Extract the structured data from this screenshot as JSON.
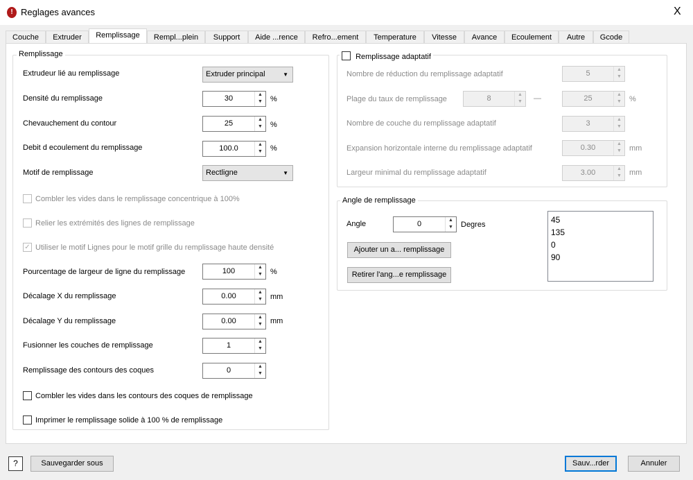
{
  "window": {
    "title": "Reglages avances",
    "close": "X"
  },
  "tabs": [
    "Couche",
    "Extruder",
    "Remplissage",
    "Rempl...plein",
    "Support",
    "Aide ...rence",
    "Refro...ement",
    "Temperature",
    "Vitesse",
    "Avance",
    "Ecoulement",
    "Autre",
    "Gcode"
  ],
  "active_tab": "Remplissage",
  "left": {
    "title": "Remplissage",
    "extruder_label": "Extrudeur lié au remplissage",
    "extruder_value": "Extruder principal",
    "density_label": "Densité du remplissage",
    "density_value": "30",
    "density_unit": "%",
    "overlap_label": "Chevauchement du contour",
    "overlap_value": "25",
    "overlap_unit": "%",
    "flow_label": "Debit d ecoulement du remplissage",
    "flow_value": "100.0",
    "flow_unit": "%",
    "pattern_label": "Motif de remplissage",
    "pattern_value": "Rectligne",
    "cb1": "Combler les vides dans le remplissage concentrique à 100%",
    "cb2": "Relier les extrémités des lignes de remplissage",
    "cb3": "Utiliser le motif Lignes pour le motif grille du remplissage haute densité",
    "width_label": "Pourcentage de largeur de ligne du remplissage",
    "width_value": "100",
    "width_unit": "%",
    "offx_label": "Décalage X du remplissage",
    "offx_value": "0.00",
    "offx_unit": "mm",
    "offy_label": "Décalage Y du remplissage",
    "offy_value": "0.00",
    "offy_unit": "mm",
    "merge_label": "Fusionner les couches de remplissage",
    "merge_value": "1",
    "shells_label": "Remplissage des contours des coques",
    "shells_value": "0",
    "cb4": "Combler les vides dans les contours des coques de remplissage",
    "cb5": "Imprimer le remplissage solide à 100 % de remplissage"
  },
  "adaptive": {
    "title": "Remplissage adaptatif",
    "checked": false,
    "reduc_label": "Nombre de réduction du remplissage adaptatif",
    "reduc_value": "5",
    "range_label": "Plage du taux de remplissage",
    "range_min": "8",
    "range_sep": "—",
    "range_max": "25",
    "range_unit": "%",
    "layers_label": "Nombre de couche du remplissage adaptatif",
    "layers_value": "3",
    "exp_label": "Expansion horizontale interne du remplissage adaptatif",
    "exp_value": "0.30",
    "exp_unit": "mm",
    "minw_label": "Largeur minimal du remplissage adaptatif",
    "minw_value": "3.00",
    "minw_unit": "mm"
  },
  "angle": {
    "title": "Angle de remplissage",
    "label": "Angle",
    "value": "0",
    "unit": "Degres",
    "add": "Ajouter un a... remplissage",
    "remove": "Retirer l'ang...e remplissage",
    "list": [
      "45",
      "135",
      "0",
      "90"
    ]
  },
  "footer": {
    "help": "?",
    "save_as": "Sauvegarder sous",
    "save": "Sauv...rder",
    "cancel": "Annuler"
  }
}
